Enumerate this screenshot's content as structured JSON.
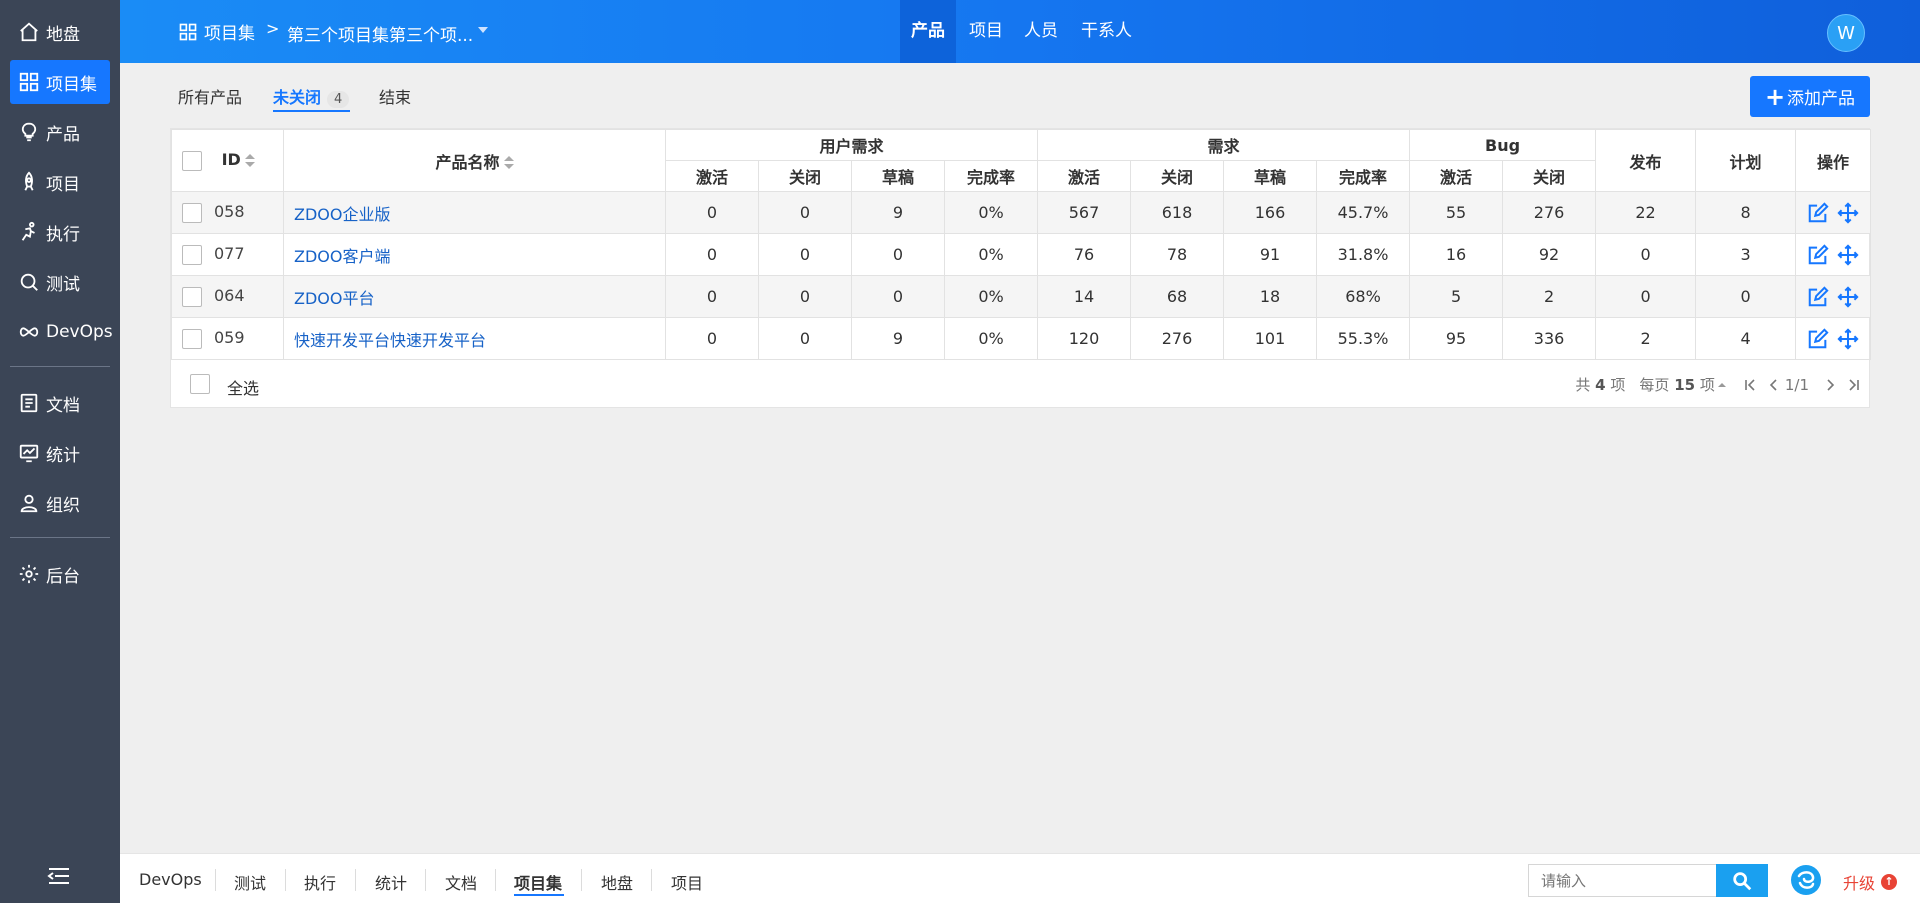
{
  "sidebar": {
    "items": [
      {
        "label": "地盘",
        "icon": "home-icon"
      },
      {
        "label": "项目集",
        "icon": "grid-icon",
        "active": true
      },
      {
        "label": "产品",
        "icon": "bulb-icon"
      },
      {
        "label": "项目",
        "icon": "rocket-icon"
      },
      {
        "label": "执行",
        "icon": "run-icon"
      },
      {
        "label": "测试",
        "icon": "bug-search-icon"
      },
      {
        "label": "DevOps",
        "icon": "infinity-icon"
      },
      {
        "label": "文档",
        "icon": "document-icon"
      },
      {
        "label": "统计",
        "icon": "monitor-chart-icon"
      },
      {
        "label": "组织",
        "icon": "user-icon"
      },
      {
        "label": "后台",
        "icon": "gear-icon"
      }
    ]
  },
  "header": {
    "home_label": "项目集",
    "separator": ">",
    "program_name": "第三个项目集第三个项...",
    "tabs": [
      {
        "label": "产品",
        "active": true
      },
      {
        "label": "项目"
      },
      {
        "label": "人员"
      },
      {
        "label": "干系人"
      }
    ],
    "avatar_letter": "W"
  },
  "filter": {
    "tabs": [
      {
        "label": "所有产品"
      },
      {
        "label": "未关闭",
        "active": true,
        "count": "4"
      },
      {
        "label": "结束"
      }
    ],
    "add_button": "添加产品",
    "add_symbol": "+"
  },
  "table": {
    "headers": {
      "id": "ID",
      "name": "产品名称",
      "user_story": "用户需求",
      "story": "需求",
      "bug": "Bug",
      "release": "发布",
      "plan": "计划",
      "actions": "操作",
      "active": "激活",
      "closed": "关闭",
      "draft": "草稿",
      "completion": "完成率"
    },
    "rows": [
      {
        "id": "058",
        "name": "ZDOO企业版",
        "us_active": "0",
        "us_closed": "0",
        "us_draft": "9",
        "us_rate": "0%",
        "st_active": "567",
        "st_closed": "618",
        "st_draft": "166",
        "st_rate": "45.7%",
        "bug_active": "55",
        "bug_closed": "276",
        "release": "22",
        "plan": "8"
      },
      {
        "id": "077",
        "name": "ZDOO客户端",
        "us_active": "0",
        "us_closed": "0",
        "us_draft": "0",
        "us_rate": "0%",
        "st_active": "76",
        "st_closed": "78",
        "st_draft": "91",
        "st_rate": "31.8%",
        "bug_active": "16",
        "bug_closed": "92",
        "release": "0",
        "plan": "3"
      },
      {
        "id": "064",
        "name": "ZDOO平台",
        "us_active": "0",
        "us_closed": "0",
        "us_draft": "0",
        "us_rate": "0%",
        "st_active": "14",
        "st_closed": "68",
        "st_draft": "18",
        "st_rate": "68%",
        "bug_active": "5",
        "bug_closed": "2",
        "release": "0",
        "plan": "0"
      },
      {
        "id": "059",
        "name": "快速开发平台快速开发平台",
        "us_active": "0",
        "us_closed": "0",
        "us_draft": "9",
        "us_rate": "0%",
        "st_active": "120",
        "st_closed": "276",
        "st_draft": "101",
        "st_rate": "55.3%",
        "bug_active": "95",
        "bug_closed": "336",
        "release": "2",
        "plan": "4"
      }
    ],
    "select_all": "全选",
    "pager": {
      "total_prefix": "共",
      "total": "4",
      "total_suffix": "项",
      "per_page_prefix": "每页",
      "per_page": "15",
      "per_page_suffix": "项",
      "page": "1/1"
    }
  },
  "bottombar": {
    "tabs": [
      {
        "label": "DevOps"
      },
      {
        "label": "测试"
      },
      {
        "label": "执行"
      },
      {
        "label": "统计"
      },
      {
        "label": "文档"
      },
      {
        "label": "项目集",
        "active": true
      },
      {
        "label": "地盘"
      },
      {
        "label": "项目"
      }
    ],
    "search_placeholder": "请输入",
    "upgrade_label": "升级"
  },
  "colors": {
    "accent": "#1677ff",
    "sidebar_bg": "#3b4556",
    "link": "#1762c7",
    "upgrade": "#e84335"
  }
}
